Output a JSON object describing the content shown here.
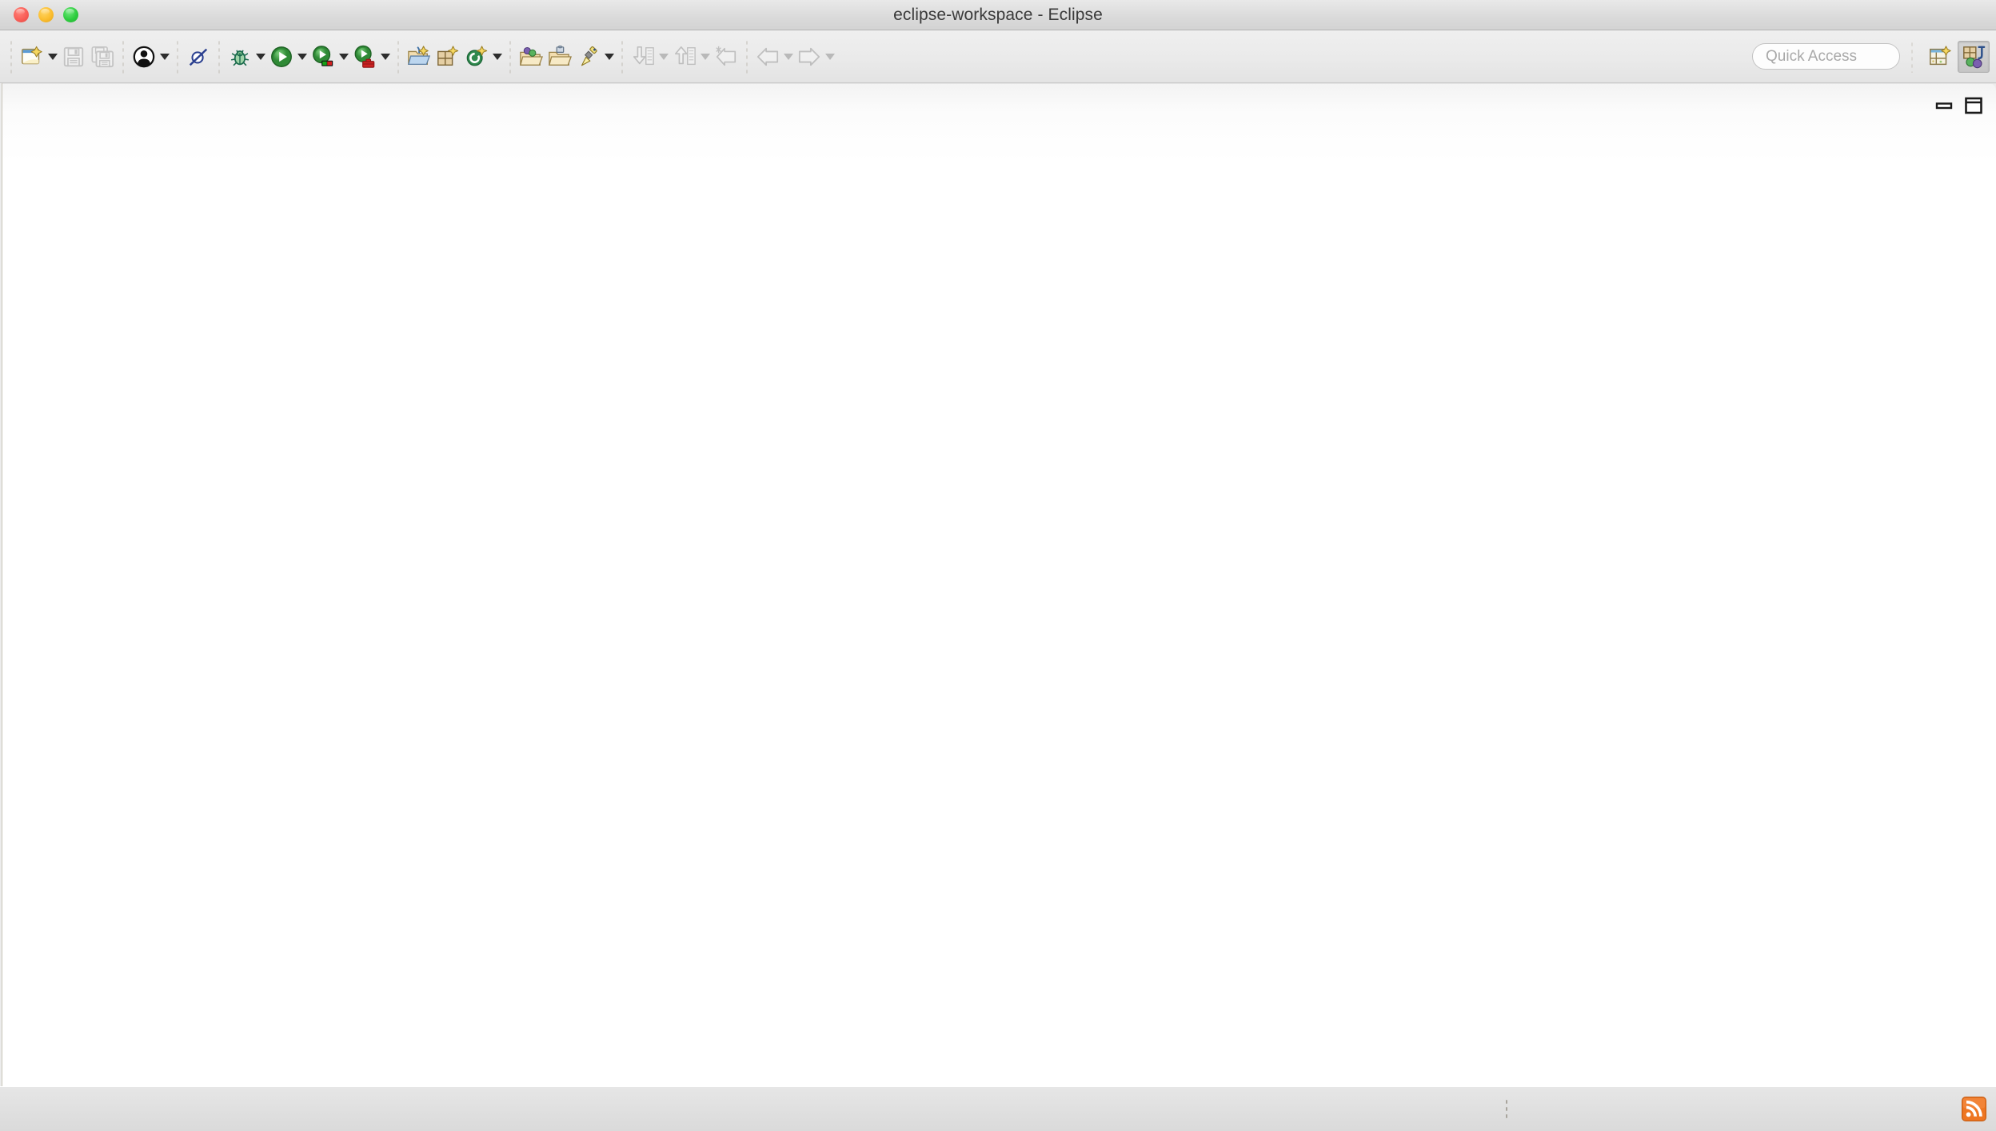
{
  "window": {
    "title": "eclipse-workspace - Eclipse",
    "traffic_lights": [
      {
        "name": "close",
        "color": "#f95e57"
      },
      {
        "name": "minimize",
        "color": "#fbbd2e"
      },
      {
        "name": "zoom",
        "color": "#2dcc3e"
      }
    ]
  },
  "toolbar": {
    "groups": [
      {
        "name": "file-group",
        "items": [
          {
            "icon": "new-wizard-icon",
            "label": "New",
            "enabled": true,
            "dropdown": true
          },
          {
            "icon": "save-icon",
            "label": "Save",
            "enabled": false,
            "dropdown": false
          },
          {
            "icon": "save-all-icon",
            "label": "Save All",
            "enabled": false,
            "dropdown": false
          }
        ]
      },
      {
        "name": "person-group",
        "items": [
          {
            "icon": "person-icon",
            "label": "User",
            "enabled": true,
            "dropdown": true
          }
        ]
      },
      {
        "name": "breakpoint-group",
        "items": [
          {
            "icon": "skip-all-breakpoints-icon",
            "label": "Skip All Breakpoints",
            "enabled": true,
            "dropdown": false
          }
        ]
      },
      {
        "name": "run-group",
        "items": [
          {
            "icon": "debug-icon",
            "label": "Debug",
            "enabled": true,
            "dropdown": true
          },
          {
            "icon": "run-icon",
            "label": "Run",
            "enabled": true,
            "dropdown": true
          },
          {
            "icon": "coverage-icon",
            "label": "Coverage",
            "enabled": true,
            "dropdown": true
          },
          {
            "icon": "external-tools-icon",
            "label": "External Tools",
            "enabled": true,
            "dropdown": true
          }
        ]
      },
      {
        "name": "new-element-group",
        "items": [
          {
            "icon": "new-java-project-icon",
            "label": "New Java Project",
            "enabled": true,
            "dropdown": false
          },
          {
            "icon": "new-java-package-icon",
            "label": "New Java Package",
            "enabled": true,
            "dropdown": false
          },
          {
            "icon": "new-java-class-icon",
            "label": "New Java Class",
            "enabled": true,
            "dropdown": true
          }
        ]
      },
      {
        "name": "open-group",
        "items": [
          {
            "icon": "open-type-icon",
            "label": "Open Type",
            "enabled": true,
            "dropdown": false
          },
          {
            "icon": "open-task-icon",
            "label": "Open Task",
            "enabled": true,
            "dropdown": false
          },
          {
            "icon": "search-icon",
            "label": "Search",
            "enabled": true,
            "dropdown": true
          }
        ]
      },
      {
        "name": "annotation-group",
        "items": [
          {
            "icon": "next-annotation-icon",
            "label": "Next Annotation",
            "enabled": false,
            "dropdown": true
          },
          {
            "icon": "previous-annotation-icon",
            "label": "Previous Annotation",
            "enabled": false,
            "dropdown": true
          },
          {
            "icon": "last-edit-location-icon",
            "label": "Last Edit Location",
            "enabled": false,
            "dropdown": false
          }
        ]
      },
      {
        "name": "history-group",
        "items": [
          {
            "icon": "back-icon",
            "label": "Back",
            "enabled": false,
            "dropdown": true
          },
          {
            "icon": "forward-icon",
            "label": "Forward",
            "enabled": false,
            "dropdown": true
          }
        ]
      }
    ],
    "quick_access": {
      "placeholder": "Quick Access",
      "value": ""
    },
    "perspectives": [
      {
        "icon": "open-perspective-icon",
        "label": "Open Perspective",
        "active": false
      },
      {
        "icon": "java-perspective-icon",
        "label": "Java",
        "active": true
      }
    ]
  },
  "editor": {
    "view_controls": [
      {
        "icon": "minimize-view-icon",
        "label": "Minimize"
      },
      {
        "icon": "maximize-view-icon",
        "label": "Maximize"
      }
    ],
    "content": ""
  },
  "statusbar": {
    "resize_handle": {
      "icon": "resize-handle-icon",
      "label": "Resize"
    },
    "trim_items": [
      {
        "icon": "rss-feed-icon",
        "label": "RSS Feed",
        "color": "#ee7622"
      }
    ]
  }
}
